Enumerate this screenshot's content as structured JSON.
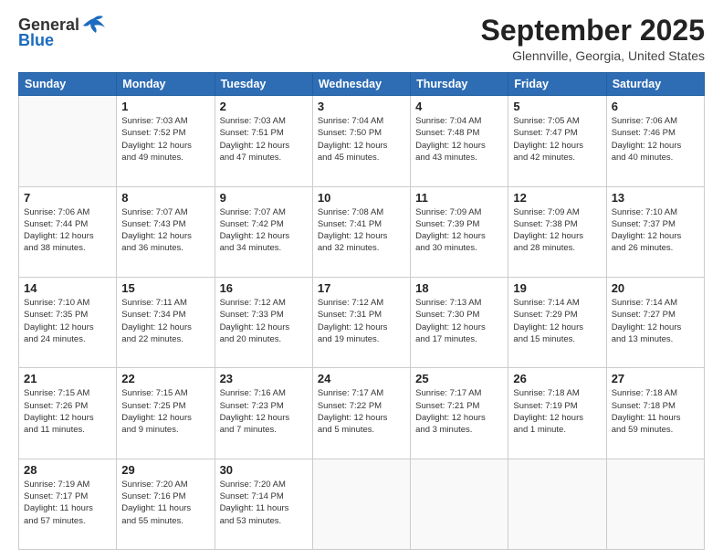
{
  "header": {
    "logo_line1": "General",
    "logo_line2": "Blue",
    "month": "September 2025",
    "location": "Glennville, Georgia, United States"
  },
  "weekdays": [
    "Sunday",
    "Monday",
    "Tuesday",
    "Wednesday",
    "Thursday",
    "Friday",
    "Saturday"
  ],
  "weeks": [
    [
      {
        "day": "",
        "info": ""
      },
      {
        "day": "1",
        "info": "Sunrise: 7:03 AM\nSunset: 7:52 PM\nDaylight: 12 hours\nand 49 minutes."
      },
      {
        "day": "2",
        "info": "Sunrise: 7:03 AM\nSunset: 7:51 PM\nDaylight: 12 hours\nand 47 minutes."
      },
      {
        "day": "3",
        "info": "Sunrise: 7:04 AM\nSunset: 7:50 PM\nDaylight: 12 hours\nand 45 minutes."
      },
      {
        "day": "4",
        "info": "Sunrise: 7:04 AM\nSunset: 7:48 PM\nDaylight: 12 hours\nand 43 minutes."
      },
      {
        "day": "5",
        "info": "Sunrise: 7:05 AM\nSunset: 7:47 PM\nDaylight: 12 hours\nand 42 minutes."
      },
      {
        "day": "6",
        "info": "Sunrise: 7:06 AM\nSunset: 7:46 PM\nDaylight: 12 hours\nand 40 minutes."
      }
    ],
    [
      {
        "day": "7",
        "info": "Sunrise: 7:06 AM\nSunset: 7:44 PM\nDaylight: 12 hours\nand 38 minutes."
      },
      {
        "day": "8",
        "info": "Sunrise: 7:07 AM\nSunset: 7:43 PM\nDaylight: 12 hours\nand 36 minutes."
      },
      {
        "day": "9",
        "info": "Sunrise: 7:07 AM\nSunset: 7:42 PM\nDaylight: 12 hours\nand 34 minutes."
      },
      {
        "day": "10",
        "info": "Sunrise: 7:08 AM\nSunset: 7:41 PM\nDaylight: 12 hours\nand 32 minutes."
      },
      {
        "day": "11",
        "info": "Sunrise: 7:09 AM\nSunset: 7:39 PM\nDaylight: 12 hours\nand 30 minutes."
      },
      {
        "day": "12",
        "info": "Sunrise: 7:09 AM\nSunset: 7:38 PM\nDaylight: 12 hours\nand 28 minutes."
      },
      {
        "day": "13",
        "info": "Sunrise: 7:10 AM\nSunset: 7:37 PM\nDaylight: 12 hours\nand 26 minutes."
      }
    ],
    [
      {
        "day": "14",
        "info": "Sunrise: 7:10 AM\nSunset: 7:35 PM\nDaylight: 12 hours\nand 24 minutes."
      },
      {
        "day": "15",
        "info": "Sunrise: 7:11 AM\nSunset: 7:34 PM\nDaylight: 12 hours\nand 22 minutes."
      },
      {
        "day": "16",
        "info": "Sunrise: 7:12 AM\nSunset: 7:33 PM\nDaylight: 12 hours\nand 20 minutes."
      },
      {
        "day": "17",
        "info": "Sunrise: 7:12 AM\nSunset: 7:31 PM\nDaylight: 12 hours\nand 19 minutes."
      },
      {
        "day": "18",
        "info": "Sunrise: 7:13 AM\nSunset: 7:30 PM\nDaylight: 12 hours\nand 17 minutes."
      },
      {
        "day": "19",
        "info": "Sunrise: 7:14 AM\nSunset: 7:29 PM\nDaylight: 12 hours\nand 15 minutes."
      },
      {
        "day": "20",
        "info": "Sunrise: 7:14 AM\nSunset: 7:27 PM\nDaylight: 12 hours\nand 13 minutes."
      }
    ],
    [
      {
        "day": "21",
        "info": "Sunrise: 7:15 AM\nSunset: 7:26 PM\nDaylight: 12 hours\nand 11 minutes."
      },
      {
        "day": "22",
        "info": "Sunrise: 7:15 AM\nSunset: 7:25 PM\nDaylight: 12 hours\nand 9 minutes."
      },
      {
        "day": "23",
        "info": "Sunrise: 7:16 AM\nSunset: 7:23 PM\nDaylight: 12 hours\nand 7 minutes."
      },
      {
        "day": "24",
        "info": "Sunrise: 7:17 AM\nSunset: 7:22 PM\nDaylight: 12 hours\nand 5 minutes."
      },
      {
        "day": "25",
        "info": "Sunrise: 7:17 AM\nSunset: 7:21 PM\nDaylight: 12 hours\nand 3 minutes."
      },
      {
        "day": "26",
        "info": "Sunrise: 7:18 AM\nSunset: 7:19 PM\nDaylight: 12 hours\nand 1 minute."
      },
      {
        "day": "27",
        "info": "Sunrise: 7:18 AM\nSunset: 7:18 PM\nDaylight: 11 hours\nand 59 minutes."
      }
    ],
    [
      {
        "day": "28",
        "info": "Sunrise: 7:19 AM\nSunset: 7:17 PM\nDaylight: 11 hours\nand 57 minutes."
      },
      {
        "day": "29",
        "info": "Sunrise: 7:20 AM\nSunset: 7:16 PM\nDaylight: 11 hours\nand 55 minutes."
      },
      {
        "day": "30",
        "info": "Sunrise: 7:20 AM\nSunset: 7:14 PM\nDaylight: 11 hours\nand 53 minutes."
      },
      {
        "day": "",
        "info": ""
      },
      {
        "day": "",
        "info": ""
      },
      {
        "day": "",
        "info": ""
      },
      {
        "day": "",
        "info": ""
      }
    ]
  ]
}
